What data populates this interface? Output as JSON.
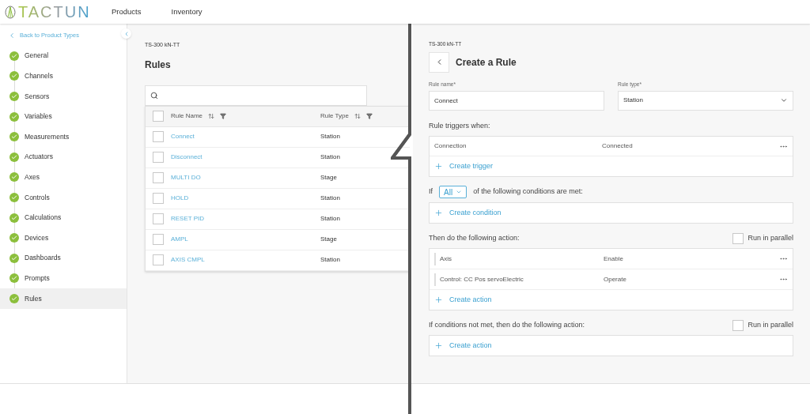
{
  "header": {
    "logo": "TACTUN",
    "nav": [
      {
        "label": "Products",
        "selected": false
      },
      {
        "label": "Inventory",
        "selected": false
      }
    ]
  },
  "sidebar": {
    "back": "Back to Product Types",
    "items": [
      {
        "label": "General",
        "done": true,
        "selected": false
      },
      {
        "label": "Channels",
        "done": true,
        "selected": false
      },
      {
        "label": "Sensors",
        "done": true,
        "selected": false
      },
      {
        "label": "Variables",
        "done": true,
        "selected": false
      },
      {
        "label": "Measurements",
        "done": true,
        "selected": false
      },
      {
        "label": "Actuators",
        "done": true,
        "selected": false
      },
      {
        "label": "Axes",
        "done": true,
        "selected": false
      },
      {
        "label": "Controls",
        "done": true,
        "selected": false
      },
      {
        "label": "Calculations",
        "done": true,
        "selected": false
      },
      {
        "label": "Devices",
        "done": true,
        "selected": false
      },
      {
        "label": "Dashboards",
        "done": true,
        "selected": false
      },
      {
        "label": "Prompts",
        "done": true,
        "selected": false
      },
      {
        "label": "Rules",
        "done": true,
        "selected": true
      }
    ]
  },
  "rules_list": {
    "breadcrumb": "TS-300 kN-TT",
    "title": "Rules",
    "select_all": {
      "checked": false
    },
    "columns": [
      "Rule Name",
      "Rule Type"
    ],
    "rows": [
      {
        "name": "Connect",
        "type": "Station",
        "checked": false
      },
      {
        "name": "Disconnect",
        "type": "Station",
        "checked": false
      },
      {
        "name": "MULTI DO",
        "type": "Stage",
        "checked": false
      },
      {
        "name": "HOLD",
        "type": "Station",
        "checked": false
      },
      {
        "name": "RESET PID",
        "type": "Station",
        "checked": false
      },
      {
        "name": "AMPL",
        "type": "Stage",
        "checked": false
      },
      {
        "name": "AXIS CMPL",
        "type": "Station",
        "checked": false
      }
    ]
  },
  "create_rule": {
    "breadcrumb": "TS-300 kN-TT",
    "title": "Create a Rule",
    "name_label": "Rule name*",
    "name_value": "Connect",
    "type_label": "Rule type*",
    "type_value": "Station",
    "triggers_label": "Rule triggers when:",
    "triggers": [
      {
        "source": "Connection",
        "event": "Connected"
      }
    ],
    "create_trigger": "Create trigger",
    "if_prefix": "If",
    "match": "All",
    "if_suffix": "of the following conditions are met:",
    "create_condition": "Create condition",
    "then_label": "Then do the following action:",
    "then_parallel": {
      "label": "Run in parallel",
      "checked": false
    },
    "actions": [
      {
        "target": "Axis",
        "action": "Enable"
      },
      {
        "target": "Control: CC Pos servoElectric",
        "action": "Operate"
      }
    ],
    "create_action": "Create action",
    "else_label": "If conditions not met, then do the following action:",
    "else_parallel": {
      "label": "Run in parallel",
      "checked": false
    },
    "else_create_action": "Create action"
  }
}
